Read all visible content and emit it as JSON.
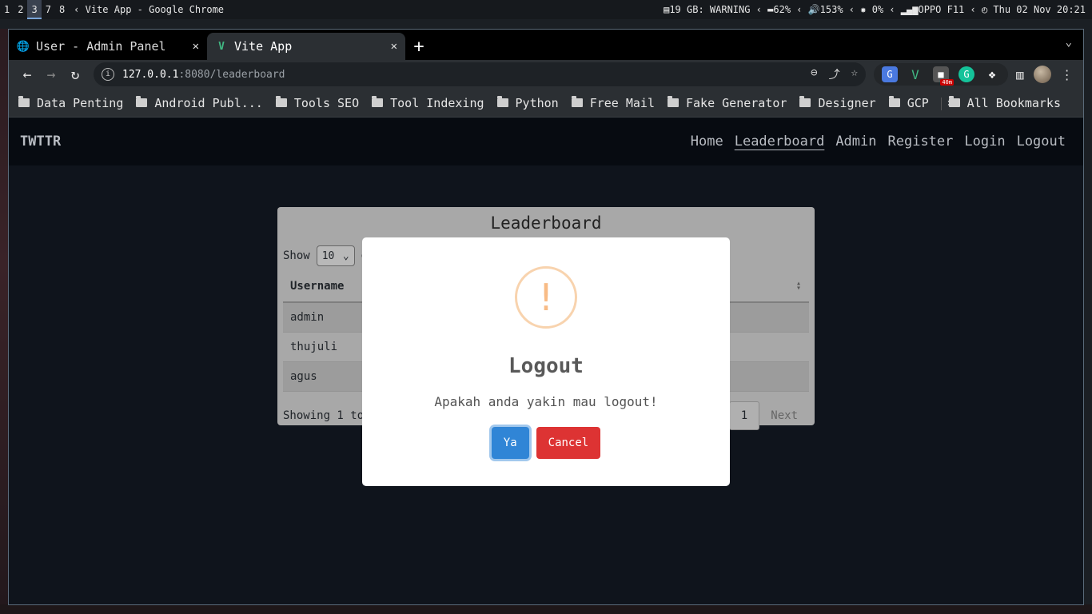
{
  "system_bar": {
    "workspaces": [
      "1",
      "2",
      "3",
      "7",
      "8"
    ],
    "active_workspace": "3",
    "window_title": "‹ Vite App - Google Chrome",
    "status": "▤19 GB: WARNING ‹ ▬62% ‹ 🔊153% ‹ ✸ 0% ‹ ▂▄▆OPPO F11 ‹ ◴ Thu 02 Nov 20:21"
  },
  "browser": {
    "tabs": [
      {
        "title": "User - Admin Panel",
        "icon": "globe-icon",
        "active": false
      },
      {
        "title": "Vite App",
        "icon": "vue-logo-icon",
        "active": true
      }
    ],
    "new_tab_label": "+",
    "url_host": "127.0.0.1",
    "url_rest": ":8080/leaderboard",
    "bookmarks": [
      "Data Penting",
      "Android Publ...",
      "Tools SEO",
      "Tool Indexing",
      "Python",
      "Free Mail",
      "Fake Generator",
      "Designer",
      "GCP"
    ],
    "bookmarks_overflow": "»",
    "all_bookmarks": "All Bookmarks",
    "extension_badge": "40m"
  },
  "app": {
    "brand": "TWTTR",
    "nav": [
      "Home",
      "Leaderboard",
      "Admin",
      "Register",
      "Login",
      "Logout"
    ],
    "active_nav": "Leaderboard"
  },
  "leaderboard": {
    "title": "Leaderboard",
    "show_label": "Show",
    "entries_value": "10",
    "entries_suffix": "e",
    "column_username": "Username",
    "rows": [
      "admin",
      "thujuli",
      "agus"
    ],
    "info_text": "Showing 1 to 3",
    "current_page": "1",
    "next_label": "Next"
  },
  "modal": {
    "icon": "!",
    "title": "Logout",
    "text": "Apakah anda yakin mau logout!",
    "confirm_label": "Ya",
    "cancel_label": "Cancel",
    "colors": {
      "confirm": "#3085d6",
      "cancel": "#dd3333",
      "warning": "#f8bb86"
    }
  }
}
